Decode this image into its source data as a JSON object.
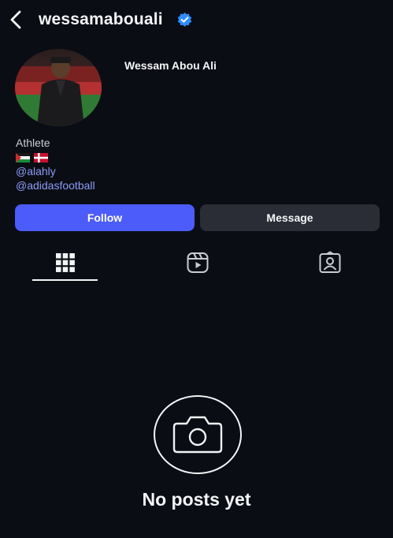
{
  "header": {
    "username": "wessamabouali",
    "verified": true,
    "verified_color": "#2f8cff",
    "back_icon": "chevron-left-icon"
  },
  "profile": {
    "full_name": "Wessam Abou Ali",
    "category": "Athlete",
    "flags": [
      "palestine-flag",
      "denmark-flag"
    ],
    "links": [
      "@alahly",
      "@adidasfootball"
    ]
  },
  "actions": {
    "follow_label": "Follow",
    "message_label": "Message",
    "follow_color": "#4b5cfa",
    "message_color": "#2a2d35"
  },
  "tabs": [
    {
      "icon": "grid-icon",
      "selected": true
    },
    {
      "icon": "reels-icon",
      "selected": false
    },
    {
      "icon": "tagged-icon",
      "selected": false
    }
  ],
  "empty_state": {
    "icon": "camera-icon",
    "text": "No posts yet"
  },
  "colors": {
    "background": "#0b0d14",
    "link": "#8d9bf7"
  }
}
